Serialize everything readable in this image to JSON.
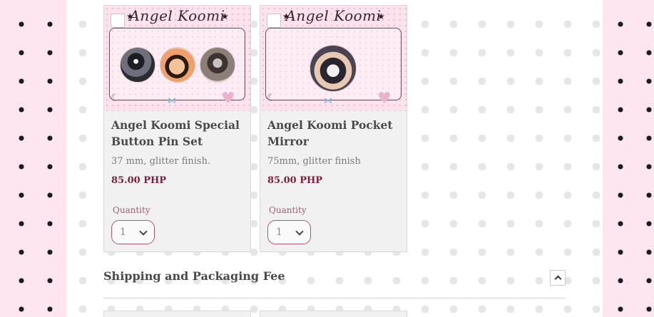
{
  "products": [
    {
      "image_brand": "Angel Koomi",
      "title": "Angel Koomi Special Button Pin Set",
      "description": "37 mm, glitter finish.",
      "price": "85.00 PHP",
      "quantity_label": "Quantity",
      "quantity_value": "1"
    },
    {
      "image_brand": "Angel Koomi",
      "title": "Angel Koomi Pocket Mirror",
      "description": "75mm, glitter finish",
      "price": "85.00 PHP",
      "quantity_label": "Quantity",
      "quantity_value": "1"
    }
  ],
  "section": {
    "title": "Shipping and Packaging Fee"
  },
  "icons": {
    "star": "★",
    "moon": "☾",
    "bow": "⋈",
    "heart": "♥",
    "collapse": "chevron-up-icon"
  },
  "colors": {
    "price": "#7a2040",
    "select_border": "#a85a72",
    "page_bg_pink": "#fde6ef",
    "card_bg": "#f1f1f1"
  }
}
